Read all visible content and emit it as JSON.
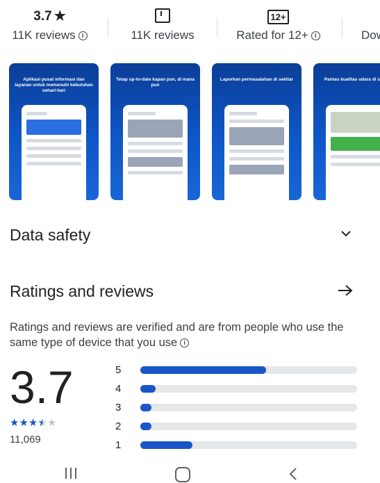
{
  "stats": [
    {
      "top": "3.7",
      "star": "★",
      "bottom": "11K reviews",
      "info": "i"
    },
    {
      "bottom": "11K reviews"
    },
    {
      "top": "12+",
      "bottom": "Rated for 12+",
      "info": "i"
    },
    {
      "bottom": "Dow"
    }
  ],
  "screenshots": [
    {
      "caption": "Aplikasi pusat informasi dan layanan untuk memenuhi kebutuhan sehari-hari"
    },
    {
      "caption": "Tetap up-to-date kapan pun, di mana pun"
    },
    {
      "caption": "Laporkan permasalahan di sekitar"
    },
    {
      "caption": "Pantau kualitas udara di sekitar"
    }
  ],
  "data_safety": {
    "title": "Data safety"
  },
  "ratings": {
    "title": "Ratings and reviews",
    "description": "Ratings and reviews are verified and are from people who use the same type of device that you use",
    "info": "i",
    "average": "3.7",
    "count": "11,069",
    "stars_filled": 3.5,
    "stars": [
      "★",
      "★",
      "★",
      "★",
      "★"
    ],
    "distribution": [
      {
        "label": "5",
        "fraction": 0.58
      },
      {
        "label": "4",
        "fraction": 0.07
      },
      {
        "label": "3",
        "fraction": 0.05
      },
      {
        "label": "2",
        "fraction": 0.05
      },
      {
        "label": "1",
        "fraction": 0.24
      }
    ]
  },
  "colors": {
    "accent": "#1a56c7",
    "bar_bg": "#e6e7e9"
  }
}
